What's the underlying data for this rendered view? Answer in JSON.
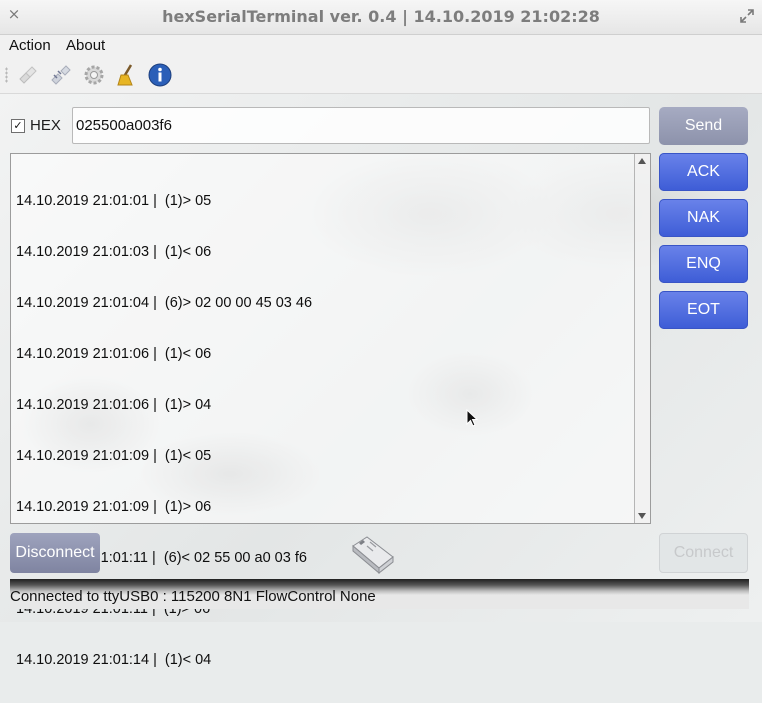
{
  "window": {
    "title": "hexSerialTerminal ver. 0.4  |  14.10.2019 21:02:28",
    "close_glyph": "×"
  },
  "menu": {
    "items": [
      "Action",
      "About"
    ]
  },
  "toolbar": {
    "icons": [
      "connect-icon",
      "disconnect-icon",
      "settings-icon",
      "clear-icon",
      "info-icon"
    ]
  },
  "send_area": {
    "hex_label": "HEX",
    "hex_checked": true,
    "hex_check_glyph": "✓",
    "input_value": "025500a003f6",
    "send_label": "Send"
  },
  "quick_buttons": [
    "ACK",
    "NAK",
    "ENQ",
    "EOT"
  ],
  "log": {
    "lines": [
      "14.10.2019 21:01:01 |  (1)> 05",
      "14.10.2019 21:01:03 |  (1)< 06",
      "14.10.2019 21:01:04 |  (6)> 02 00 00 45 03 46",
      "14.10.2019 21:01:06 |  (1)< 06",
      "14.10.2019 21:01:06 |  (1)> 04",
      "14.10.2019 21:01:09 |  (1)< 05",
      "14.10.2019 21:01:09 |  (1)> 06",
      "14.10.2019 21:01:11 |  (6)< 02 55 00 a0 03 f6",
      "14.10.2019 21:01:11 |  (1)> 06",
      "14.10.2019 21:01:14 |  (1)< 04"
    ]
  },
  "bottom": {
    "disconnect_label": "Disconnect",
    "connect_label": "Connect"
  },
  "status": {
    "text": "Connected to ttyUSB0 : 115200 8N1 FlowControl None"
  },
  "colors": {
    "accent_blue": "#4a67dc",
    "muted_button": "#9297b1"
  }
}
